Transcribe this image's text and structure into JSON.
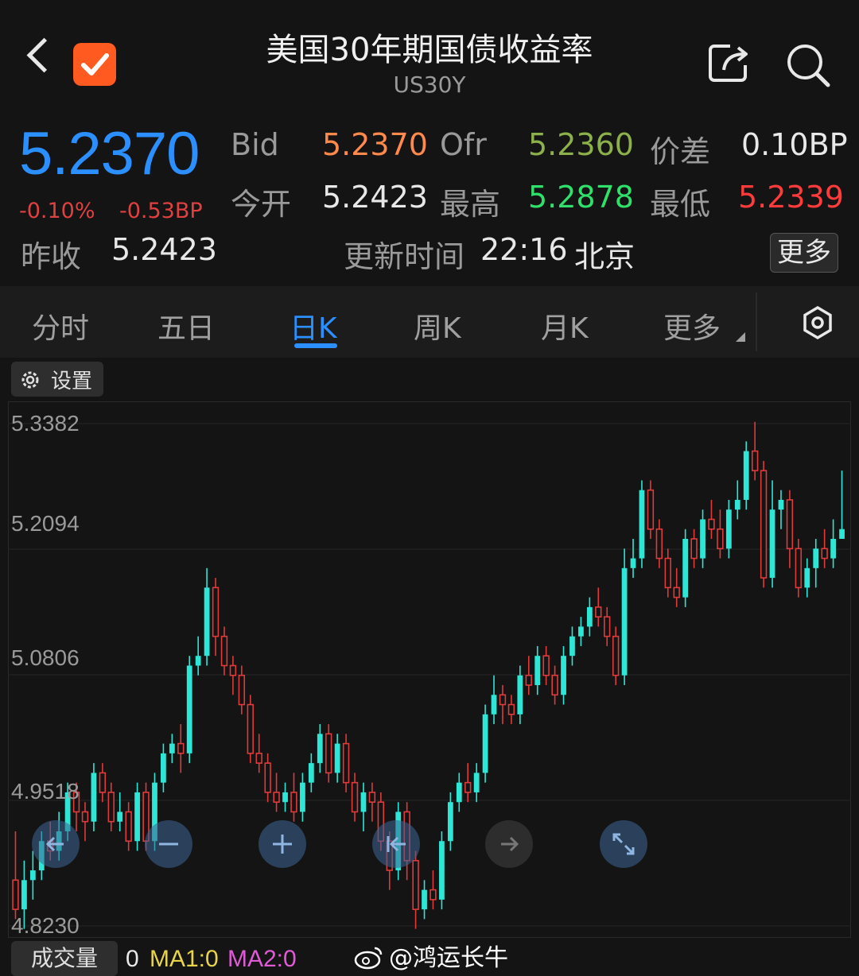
{
  "header": {
    "title": "美国30年期国债收益率",
    "symbol": "US30Y"
  },
  "quote": {
    "price": "5.2370",
    "change_pct": "-0.10%",
    "change_bp": "-0.53BP",
    "prev_close_label": "昨收",
    "prev_close": "5.2423",
    "bid_label": "Bid",
    "bid": "5.2370",
    "ofr_label": "Ofr",
    "ofr": "5.2360",
    "spread_label": "价差",
    "spread": "0.10BP",
    "open_label": "今开",
    "open": "5.2423",
    "high_label": "最高",
    "high": "5.2878",
    "low_label": "最低",
    "low": "5.2339",
    "update_label": "更新时间",
    "update_time": "22:16",
    "update_zone": "北京",
    "more_label": "更多"
  },
  "tabs": [
    {
      "label": "分时",
      "active": false
    },
    {
      "label": "五日",
      "active": false
    },
    {
      "label": "日K",
      "active": true
    },
    {
      "label": "周K",
      "active": false
    },
    {
      "label": "月K",
      "active": false
    },
    {
      "label": "更多",
      "active": false
    }
  ],
  "settings_label": "设置",
  "volume": {
    "label": "成交量",
    "value": "0",
    "ma1": "MA1:0",
    "ma2": "MA2:0"
  },
  "watermark": "@鸿运长牛",
  "colors": {
    "up": "#2ee6d6",
    "down": "#e03a3a",
    "accent": "#2b8fff"
  },
  "chart_data": {
    "type": "candlestick",
    "y_ticks": [
      "5.3382",
      "5.2094",
      "5.0806",
      "4.9518",
      "4.8230"
    ],
    "ylim": [
      4.823,
      5.3382
    ],
    "candles": [
      [
        4.87,
        4.84,
        4.92,
        4.83
      ],
      [
        4.84,
        4.87,
        4.89,
        4.82
      ],
      [
        4.87,
        4.88,
        4.9,
        4.85
      ],
      [
        4.88,
        4.91,
        4.92,
        4.87
      ],
      [
        4.91,
        4.9,
        4.93,
        4.89
      ],
      [
        4.9,
        4.92,
        4.94,
        4.89
      ],
      [
        4.92,
        4.96,
        4.97,
        4.91
      ],
      [
        4.96,
        4.94,
        4.97,
        4.92
      ],
      [
        4.94,
        4.93,
        4.95,
        4.91
      ],
      [
        4.93,
        4.98,
        4.99,
        4.92
      ],
      [
        4.98,
        4.96,
        4.99,
        4.95
      ],
      [
        4.96,
        4.93,
        4.97,
        4.92
      ],
      [
        4.93,
        4.94,
        4.96,
        4.92
      ],
      [
        4.94,
        4.91,
        4.95,
        4.9
      ],
      [
        4.91,
        4.96,
        4.97,
        4.9
      ],
      [
        4.96,
        4.91,
        4.97,
        4.9
      ],
      [
        4.91,
        4.97,
        4.98,
        4.9
      ],
      [
        4.97,
        5.0,
        5.01,
        4.96
      ],
      [
        5.0,
        5.01,
        5.02,
        4.99
      ],
      [
        5.01,
        5.0,
        5.03,
        4.98
      ],
      [
        5.0,
        5.09,
        5.1,
        4.99
      ],
      [
        5.09,
        5.1,
        5.12,
        5.08
      ],
      [
        5.1,
        5.17,
        5.19,
        5.09
      ],
      [
        5.17,
        5.12,
        5.18,
        5.1
      ],
      [
        5.12,
        5.09,
        5.13,
        5.08
      ],
      [
        5.09,
        5.08,
        5.1,
        5.06
      ],
      [
        5.08,
        5.05,
        5.09,
        5.04
      ],
      [
        5.05,
        5.0,
        5.06,
        4.99
      ],
      [
        5.0,
        4.99,
        5.02,
        4.98
      ],
      [
        4.99,
        4.96,
        5.0,
        4.95
      ],
      [
        4.96,
        4.95,
        4.98,
        4.94
      ],
      [
        4.95,
        4.96,
        4.97,
        4.94
      ],
      [
        4.96,
        4.94,
        4.98,
        4.93
      ],
      [
        4.94,
        4.97,
        4.98,
        4.93
      ],
      [
        4.97,
        4.99,
        5.0,
        4.96
      ],
      [
        4.99,
        5.02,
        5.03,
        4.98
      ],
      [
        5.02,
        4.98,
        5.03,
        4.97
      ],
      [
        4.98,
        5.01,
        5.02,
        4.97
      ],
      [
        5.01,
        4.97,
        5.02,
        4.96
      ],
      [
        4.97,
        4.94,
        4.98,
        4.93
      ],
      [
        4.94,
        4.96,
        4.97,
        4.92
      ],
      [
        4.96,
        4.95,
        4.97,
        4.93
      ],
      [
        4.95,
        4.91,
        4.96,
        4.9
      ],
      [
        4.91,
        4.88,
        4.92,
        4.86
      ],
      [
        4.88,
        4.94,
        4.95,
        4.87
      ],
      [
        4.94,
        4.89,
        4.95,
        4.87
      ],
      [
        4.89,
        4.84,
        4.9,
        4.82
      ],
      [
        4.84,
        4.86,
        4.87,
        4.83
      ],
      [
        4.86,
        4.85,
        4.88,
        4.84
      ],
      [
        4.85,
        4.91,
        4.92,
        4.84
      ],
      [
        4.91,
        4.95,
        4.96,
        4.9
      ],
      [
        4.95,
        4.97,
        4.98,
        4.94
      ],
      [
        4.97,
        4.96,
        4.99,
        4.95
      ],
      [
        4.96,
        4.98,
        4.99,
        4.95
      ],
      [
        4.98,
        5.04,
        5.05,
        4.97
      ],
      [
        5.04,
        5.06,
        5.08,
        5.03
      ],
      [
        5.06,
        5.05,
        5.07,
        5.03
      ],
      [
        5.05,
        5.04,
        5.06,
        5.03
      ],
      [
        5.04,
        5.08,
        5.09,
        5.03
      ],
      [
        5.08,
        5.07,
        5.1,
        5.06
      ],
      [
        5.07,
        5.1,
        5.11,
        5.06
      ],
      [
        5.1,
        5.08,
        5.11,
        5.07
      ],
      [
        5.08,
        5.06,
        5.09,
        5.05
      ],
      [
        5.06,
        5.1,
        5.11,
        5.05
      ],
      [
        5.1,
        5.12,
        5.13,
        5.09
      ],
      [
        5.12,
        5.13,
        5.14,
        5.11
      ],
      [
        5.13,
        5.15,
        5.16,
        5.12
      ],
      [
        5.15,
        5.14,
        5.17,
        5.13
      ],
      [
        5.14,
        5.12,
        5.15,
        5.11
      ],
      [
        5.12,
        5.08,
        5.13,
        5.07
      ],
      [
        5.08,
        5.19,
        5.21,
        5.07
      ],
      [
        5.19,
        5.2,
        5.22,
        5.18
      ],
      [
        5.2,
        5.27,
        5.28,
        5.19
      ],
      [
        5.27,
        5.23,
        5.28,
        5.22
      ],
      [
        5.23,
        5.2,
        5.24,
        5.19
      ],
      [
        5.2,
        5.17,
        5.21,
        5.16
      ],
      [
        5.17,
        5.16,
        5.19,
        5.15
      ],
      [
        5.16,
        5.22,
        5.23,
        5.15
      ],
      [
        5.22,
        5.2,
        5.23,
        5.19
      ],
      [
        5.2,
        5.24,
        5.25,
        5.19
      ],
      [
        5.24,
        5.23,
        5.26,
        5.22
      ],
      [
        5.23,
        5.21,
        5.25,
        5.2
      ],
      [
        5.21,
        5.25,
        5.26,
        5.2
      ],
      [
        5.25,
        5.26,
        5.28,
        5.24
      ],
      [
        5.26,
        5.31,
        5.32,
        5.25
      ],
      [
        5.31,
        5.29,
        5.34,
        5.28
      ],
      [
        5.29,
        5.18,
        5.3,
        5.17
      ],
      [
        5.18,
        5.25,
        5.28,
        5.17
      ],
      [
        5.25,
        5.26,
        5.27,
        5.23
      ],
      [
        5.26,
        5.21,
        5.27,
        5.19
      ],
      [
        5.21,
        5.17,
        5.22,
        5.16
      ],
      [
        5.17,
        5.19,
        5.2,
        5.16
      ],
      [
        5.19,
        5.21,
        5.22,
        5.17
      ],
      [
        5.21,
        5.2,
        5.23,
        5.19
      ],
      [
        5.2,
        5.22,
        5.24,
        5.19
      ],
      [
        5.22,
        5.23,
        5.29,
        5.22
      ]
    ]
  }
}
